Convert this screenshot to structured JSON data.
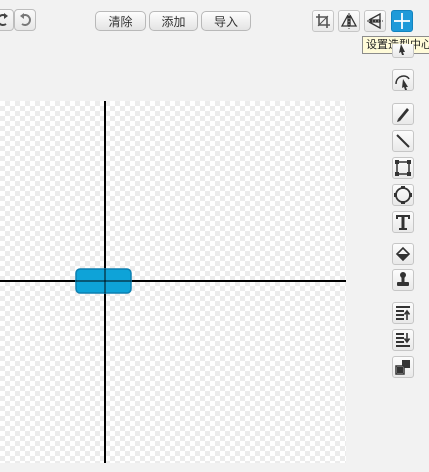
{
  "toolbar": {
    "clear_label": "清除",
    "add_label": "添加",
    "import_label": "导入"
  },
  "tooltip": {
    "text": "设置造型中心"
  },
  "colors": {
    "accent": "#1f9ad9",
    "shape_fill": "#0ea3d8",
    "shape_border": "#0c7fb0",
    "crosshair": "#000000"
  },
  "icons": {
    "top": [
      "undo-icon",
      "redo-icon",
      "crop-icon",
      "flip-horizontal-icon",
      "flip-vertical-icon",
      "set-center-icon"
    ],
    "tools": [
      "reshape-icon",
      "pencil-icon",
      "line-icon",
      "rectangle-icon",
      "ellipse-icon",
      "text-icon",
      "fill-icon",
      "stamp-icon",
      "bring-forward-icon",
      "send-backward-icon",
      "layers-icon"
    ]
  }
}
